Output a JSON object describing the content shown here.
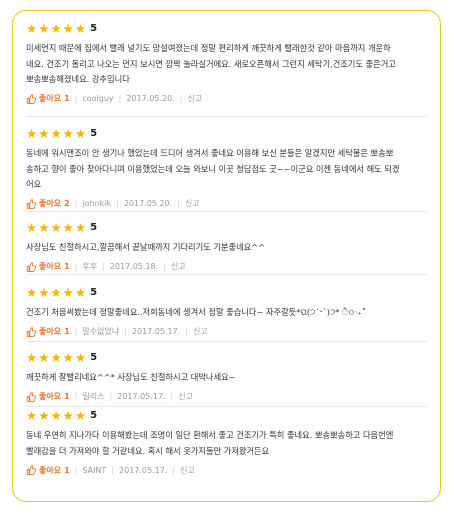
{
  "review_label": {
    "like": "좋아요",
    "report": "신고"
  },
  "reviews": [
    {
      "score": "5",
      "lines": [
        "미세먼지 때문에 집에서 빨래 널기도 망설여졌는데 정말 편리하게 깨끗하게 빨래한것 같아 마음까지 개운하",
        "네요. 건조기 돌리고 나오는 먼지 보시면 깜짝 놀라실거에요. 새로오픈해서 그런지 세탁기,건조기도 좋은거고",
        "뽀송뽀송해졌네요. 강추입니다"
      ],
      "likes": "1",
      "author": "coolguy",
      "date": "2017.05.20."
    },
    {
      "score": "5",
      "lines": [
        "동네에 워시맨조이 안 생기나 했었는데 드디어 생겨서 좋네요 이용해 보신 분들은 알겠지만 세탁물은 뽀송뽀",
        "송하고 향이 좋아 찾아다니며 이용했었는데 오늘 와보니 이곳 청담점도 굿~~이군요 이젠 동네에서 해도 되겠",
        "어요"
      ],
      "likes": "2",
      "author": "johnkik",
      "date": "2017.05.20."
    },
    {
      "score": "5",
      "lines": [
        "사장님도 친절하시고,깔끔해서 끝날때까지 기다리기도 기분좋네요^^"
      ],
      "likes": "1",
      "author": "후후",
      "date": "2017.05.18."
    },
    {
      "score": "5",
      "lines": [
        "건조기 처음써봤는데 정말좋네요..저희동네에 생겨서 정말 좋습니다~ 자주갈듯*ଘ(੭ˊᵕˋ)੭* ੈ✩‧₊˚"
      ],
      "likes": "1",
      "author": "말수없었냐",
      "date": "2017.05.17."
    },
    {
      "score": "5",
      "lines": [
        "깨끗하게 잘빨리네요^^* 사장님도 친절하시고 대박나세요~"
      ],
      "likes": "1",
      "author": "릴리스",
      "date": "2017.05.17."
    },
    {
      "score": "5",
      "lines": [
        "동네 우연히 지나가다 이용해봤는데 조명이 일단 환해서 좋고 건조기가 특히 좋네요. 뽀송뽀송하고 다음번엔",
        "빨래감을 더 가져와야 할 거같네요. 혹시 해서 옷가지들만 가져왔거든요"
      ],
      "likes": "1",
      "author": "SAINT",
      "date": "2017.05.17."
    }
  ],
  "colors": {
    "border": "#f2c41d",
    "star": "#f5b400",
    "like": "#e8742d"
  }
}
